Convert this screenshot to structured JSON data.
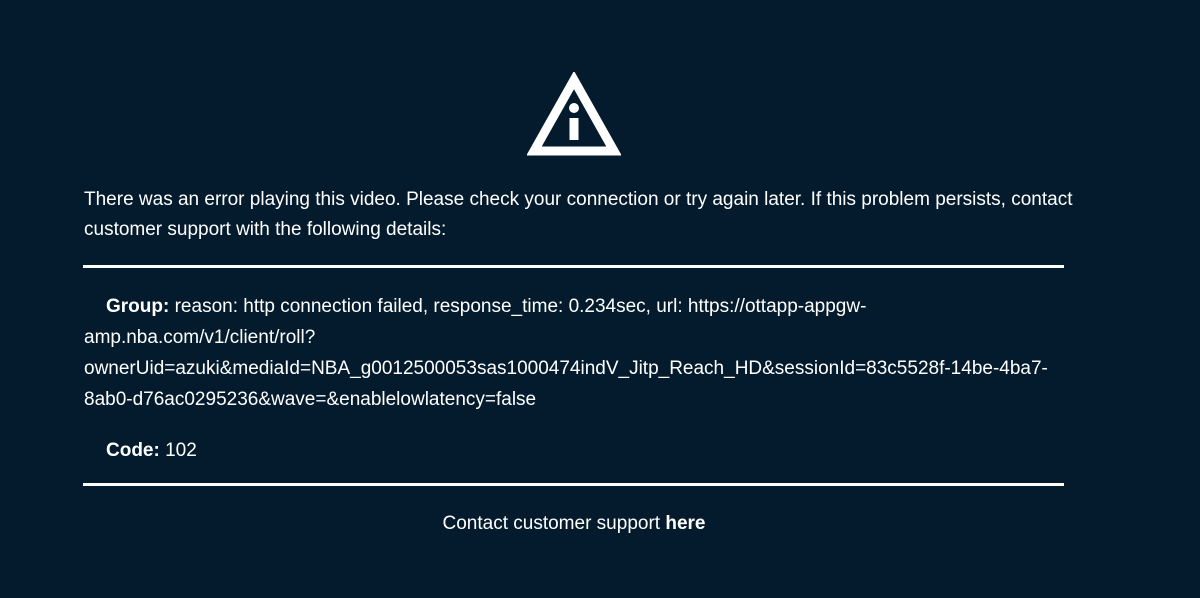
{
  "icons": {
    "warning": "warning-info-triangle-icon"
  },
  "colors": {
    "background": "#041b2d",
    "foreground": "#ffffff"
  },
  "message": "There was an error playing this video. Please check your connection or try again later. If this problem persists, contact customer support with the following details:",
  "details": {
    "group_label": "Group:",
    "group_value": "reason: http connection failed, response_time: 0.234sec, url: https://ottapp-appgw-amp.nba.com/v1/client/roll?ownerUid=azuki&mediaId=NBA_g0012500053sas1000474indV_Jitp_Reach_HD&sessionId=83c5528f-14be-4ba7-8ab0-d76ac0295236&wave=&enablelowlatency=false",
    "code_label": "Code:",
    "code_value": "102"
  },
  "support": {
    "text": "Contact customer support",
    "link_label": "here"
  }
}
